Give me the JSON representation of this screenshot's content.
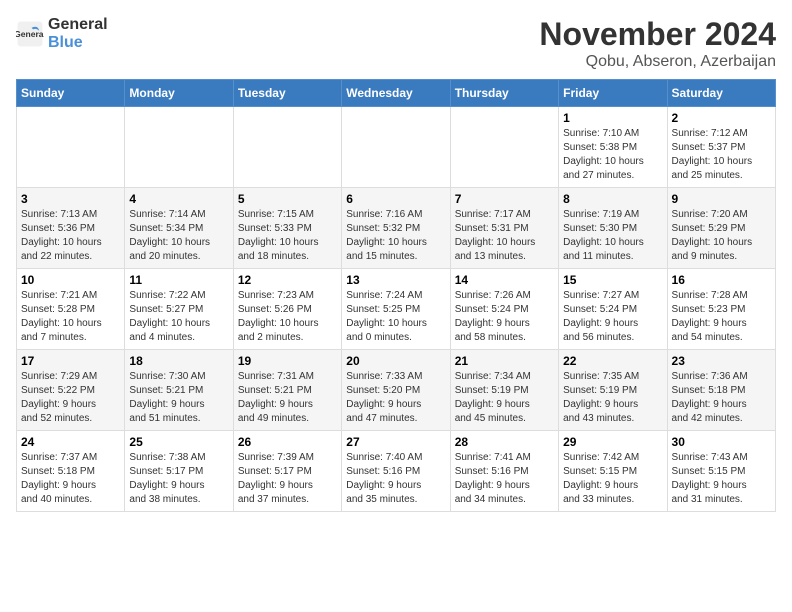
{
  "header": {
    "logo_line1": "General",
    "logo_line2": "Blue",
    "month": "November 2024",
    "location": "Qobu, Abseron, Azerbaijan"
  },
  "weekdays": [
    "Sunday",
    "Monday",
    "Tuesday",
    "Wednesday",
    "Thursday",
    "Friday",
    "Saturday"
  ],
  "weeks": [
    [
      {
        "day": "",
        "info": ""
      },
      {
        "day": "",
        "info": ""
      },
      {
        "day": "",
        "info": ""
      },
      {
        "day": "",
        "info": ""
      },
      {
        "day": "",
        "info": ""
      },
      {
        "day": "1",
        "info": "Sunrise: 7:10 AM\nSunset: 5:38 PM\nDaylight: 10 hours\nand 27 minutes."
      },
      {
        "day": "2",
        "info": "Sunrise: 7:12 AM\nSunset: 5:37 PM\nDaylight: 10 hours\nand 25 minutes."
      }
    ],
    [
      {
        "day": "3",
        "info": "Sunrise: 7:13 AM\nSunset: 5:36 PM\nDaylight: 10 hours\nand 22 minutes."
      },
      {
        "day": "4",
        "info": "Sunrise: 7:14 AM\nSunset: 5:34 PM\nDaylight: 10 hours\nand 20 minutes."
      },
      {
        "day": "5",
        "info": "Sunrise: 7:15 AM\nSunset: 5:33 PM\nDaylight: 10 hours\nand 18 minutes."
      },
      {
        "day": "6",
        "info": "Sunrise: 7:16 AM\nSunset: 5:32 PM\nDaylight: 10 hours\nand 15 minutes."
      },
      {
        "day": "7",
        "info": "Sunrise: 7:17 AM\nSunset: 5:31 PM\nDaylight: 10 hours\nand 13 minutes."
      },
      {
        "day": "8",
        "info": "Sunrise: 7:19 AM\nSunset: 5:30 PM\nDaylight: 10 hours\nand 11 minutes."
      },
      {
        "day": "9",
        "info": "Sunrise: 7:20 AM\nSunset: 5:29 PM\nDaylight: 10 hours\nand 9 minutes."
      }
    ],
    [
      {
        "day": "10",
        "info": "Sunrise: 7:21 AM\nSunset: 5:28 PM\nDaylight: 10 hours\nand 7 minutes."
      },
      {
        "day": "11",
        "info": "Sunrise: 7:22 AM\nSunset: 5:27 PM\nDaylight: 10 hours\nand 4 minutes."
      },
      {
        "day": "12",
        "info": "Sunrise: 7:23 AM\nSunset: 5:26 PM\nDaylight: 10 hours\nand 2 minutes."
      },
      {
        "day": "13",
        "info": "Sunrise: 7:24 AM\nSunset: 5:25 PM\nDaylight: 10 hours\nand 0 minutes."
      },
      {
        "day": "14",
        "info": "Sunrise: 7:26 AM\nSunset: 5:24 PM\nDaylight: 9 hours\nand 58 minutes."
      },
      {
        "day": "15",
        "info": "Sunrise: 7:27 AM\nSunset: 5:24 PM\nDaylight: 9 hours\nand 56 minutes."
      },
      {
        "day": "16",
        "info": "Sunrise: 7:28 AM\nSunset: 5:23 PM\nDaylight: 9 hours\nand 54 minutes."
      }
    ],
    [
      {
        "day": "17",
        "info": "Sunrise: 7:29 AM\nSunset: 5:22 PM\nDaylight: 9 hours\nand 52 minutes."
      },
      {
        "day": "18",
        "info": "Sunrise: 7:30 AM\nSunset: 5:21 PM\nDaylight: 9 hours\nand 51 minutes."
      },
      {
        "day": "19",
        "info": "Sunrise: 7:31 AM\nSunset: 5:21 PM\nDaylight: 9 hours\nand 49 minutes."
      },
      {
        "day": "20",
        "info": "Sunrise: 7:33 AM\nSunset: 5:20 PM\nDaylight: 9 hours\nand 47 minutes."
      },
      {
        "day": "21",
        "info": "Sunrise: 7:34 AM\nSunset: 5:19 PM\nDaylight: 9 hours\nand 45 minutes."
      },
      {
        "day": "22",
        "info": "Sunrise: 7:35 AM\nSunset: 5:19 PM\nDaylight: 9 hours\nand 43 minutes."
      },
      {
        "day": "23",
        "info": "Sunrise: 7:36 AM\nSunset: 5:18 PM\nDaylight: 9 hours\nand 42 minutes."
      }
    ],
    [
      {
        "day": "24",
        "info": "Sunrise: 7:37 AM\nSunset: 5:18 PM\nDaylight: 9 hours\nand 40 minutes."
      },
      {
        "day": "25",
        "info": "Sunrise: 7:38 AM\nSunset: 5:17 PM\nDaylight: 9 hours\nand 38 minutes."
      },
      {
        "day": "26",
        "info": "Sunrise: 7:39 AM\nSunset: 5:17 PM\nDaylight: 9 hours\nand 37 minutes."
      },
      {
        "day": "27",
        "info": "Sunrise: 7:40 AM\nSunset: 5:16 PM\nDaylight: 9 hours\nand 35 minutes."
      },
      {
        "day": "28",
        "info": "Sunrise: 7:41 AM\nSunset: 5:16 PM\nDaylight: 9 hours\nand 34 minutes."
      },
      {
        "day": "29",
        "info": "Sunrise: 7:42 AM\nSunset: 5:15 PM\nDaylight: 9 hours\nand 33 minutes."
      },
      {
        "day": "30",
        "info": "Sunrise: 7:43 AM\nSunset: 5:15 PM\nDaylight: 9 hours\nand 31 minutes."
      }
    ]
  ]
}
